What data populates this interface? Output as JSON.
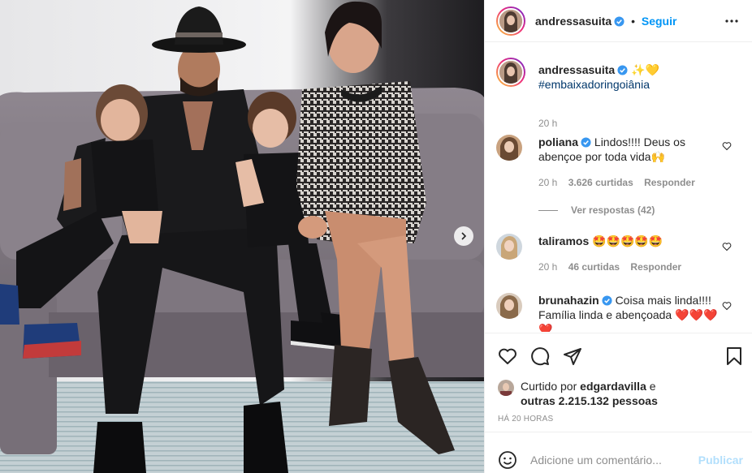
{
  "post": {
    "author": "andressasuita",
    "follow_separator": "•",
    "follow_label": "Seguir",
    "more_icon": "ellipsis-icon"
  },
  "caption": {
    "username": "andressasuita",
    "emojis": "✨💛",
    "hashtag": "#embaixadoringoiânia",
    "time": "20 h"
  },
  "comments": [
    {
      "username": "poliana",
      "verified": true,
      "text_line1": "Lindos!!!! Deus os",
      "text_line2": "abençoe por toda vida🙌",
      "time": "20 h",
      "likes": "3.626 curtidas",
      "reply": "Responder",
      "view_replies": "Ver respostas (42)"
    },
    {
      "username": "taliramos",
      "verified": false,
      "text_line1": "🤩🤩🤩🤩🤩",
      "time": "20 h",
      "likes": "46 curtidas",
      "reply": "Responder"
    },
    {
      "username": "brunahazin",
      "verified": true,
      "text_line1": "Coisa mais linda!!!!",
      "text_line2": "Família linda e abençoada ❤️❤️❤️",
      "text_line3": "❤️"
    }
  ],
  "likes": {
    "prefix": "Curtido por",
    "user": "edgardavilla",
    "conj": "e",
    "others": "outras 2.215.132 pessoas"
  },
  "timestamp": "HÁ 20 HORAS",
  "add_comment": {
    "placeholder": "Adicione um comentário...",
    "publish_label": "Publicar"
  },
  "icons": {
    "like": "heart-icon",
    "comment": "comment-icon",
    "share": "share-icon",
    "save": "bookmark-icon",
    "emoji": "smiley-icon",
    "next": "chevron-right-icon",
    "verified": "verified-badge-icon"
  },
  "colors": {
    "accent": "#0095f6",
    "hashtag": "#00376b",
    "muted": "#8e8e8e",
    "publish_disabled": "#b2dffc",
    "verified": "#3897f0"
  }
}
